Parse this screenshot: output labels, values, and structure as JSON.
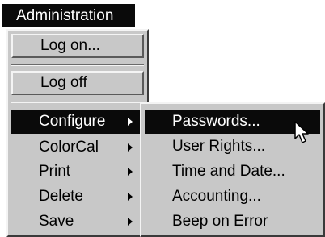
{
  "menubar": {
    "title": "Administration"
  },
  "main_menu": {
    "items": [
      {
        "label": "Log on..."
      },
      {
        "label": "Log off"
      },
      {
        "label": "Configure"
      },
      {
        "label": "ColorCal"
      },
      {
        "label": "Print"
      },
      {
        "label": "Delete"
      },
      {
        "label": "Save"
      }
    ]
  },
  "configure_submenu": {
    "items": [
      {
        "label": "Passwords..."
      },
      {
        "label": "User Rights..."
      },
      {
        "label": "Time and Date..."
      },
      {
        "label": "Accounting..."
      },
      {
        "label": "Beep on Error"
      }
    ]
  },
  "colors": {
    "highlight": "#0a0a0a",
    "menu_bg": "#c8c8c8"
  },
  "icons": {
    "pointer": "arrow-cursor-icon",
    "submenu": "triangle-right-icon"
  }
}
